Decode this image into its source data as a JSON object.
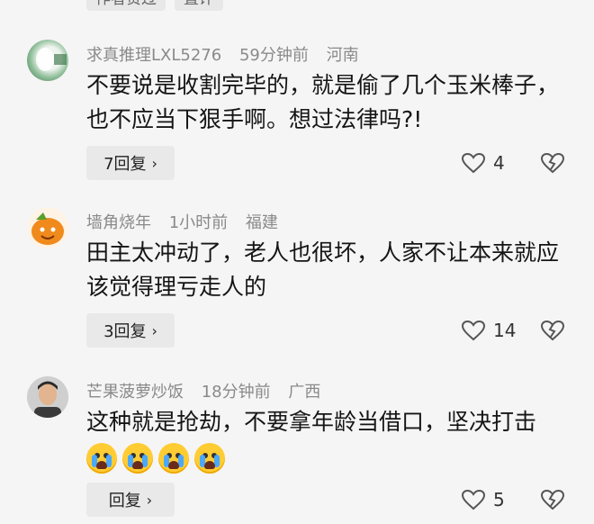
{
  "top_tags": [
    "作者赞过",
    "置评"
  ],
  "comments": [
    {
      "username": "求真推理LXL5276",
      "time": "59分钟前",
      "location": "河南",
      "text": "不要说是收割完毕的，就是偷了几个玉米棒子，也不应当下狠手啊。想过法律吗?!",
      "reply_label": "7回复",
      "likes": "4"
    },
    {
      "username": "墙角烧年",
      "time": "1小时前",
      "location": "福建",
      "text": "田主太冲动了，老人也很坏，人家不让本来就应该觉得理亏走人的",
      "reply_label": "3回复",
      "likes": "14"
    },
    {
      "username": "芒果菠萝炒饭",
      "time": "18分钟前",
      "location": "广西",
      "text": "这种就是抢劫，不要拿年龄当借口，坚决打击",
      "reply_label": "回复",
      "likes": "5",
      "emoji": [
        "crying-face",
        "crying-face",
        "crying-face",
        "crying-face"
      ]
    }
  ],
  "icons": {
    "reply_chevron": "chevron-right-icon",
    "like": "heart-outline-icon",
    "dislike": "broken-heart-icon"
  }
}
